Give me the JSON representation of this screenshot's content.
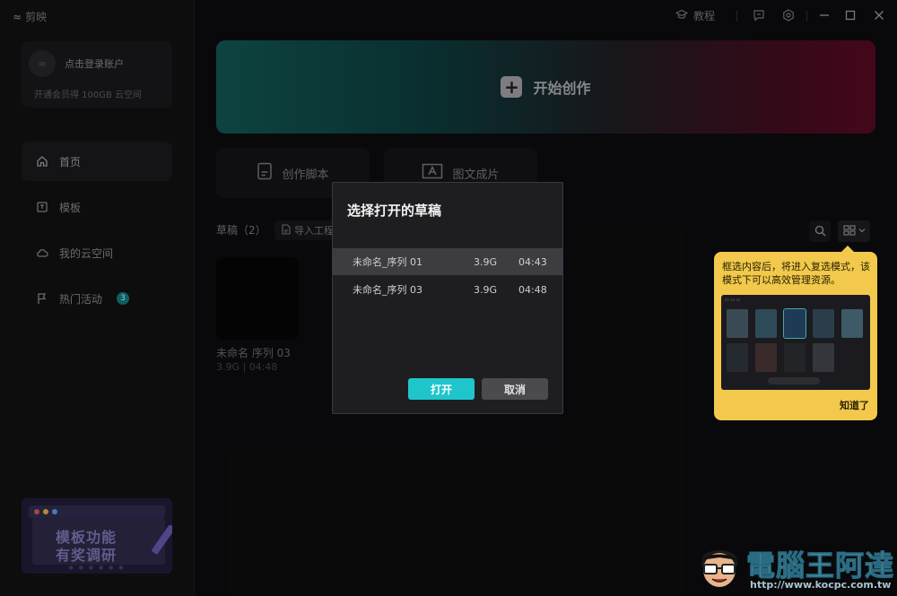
{
  "app": {
    "title": "剪映"
  },
  "account": {
    "login": "点击登录账户",
    "vip": "开通会员得 100GB 云空间"
  },
  "nav": [
    {
      "id": "home",
      "label": "首页",
      "icon": "home-icon"
    },
    {
      "id": "template",
      "label": "模板",
      "icon": "template-icon"
    },
    {
      "id": "cloud",
      "label": "我的云空间",
      "icon": "cloud-icon"
    },
    {
      "id": "events",
      "label": "热门活动",
      "icon": "flag-icon",
      "badge": "3"
    }
  ],
  "promo": {
    "line1": "模板功能",
    "line2": "有奖调研"
  },
  "topbar": {
    "tutorial": "教程"
  },
  "main": {
    "start_label": "开始创作",
    "script_label": "创作脚本",
    "image_text_label": "图文成片",
    "drafts_label": "草稿（2）",
    "import_label": "导入工程"
  },
  "draft": {
    "name": "未命名 序列 03",
    "meta": "3.9G | 04:48"
  },
  "modal": {
    "title": "选择打开的草稿",
    "rows": [
      {
        "name": "未命名_序列 01",
        "size": "3.9G",
        "time": "04:43"
      },
      {
        "name": "未命名_序列 03",
        "size": "3.9G",
        "time": "04:48"
      }
    ],
    "open_label": "打开",
    "cancel_label": "取消"
  },
  "tip": {
    "text": "框选内容后，将进入复选模式，该模式下可以高效管理资源。",
    "ok_label": "知道了"
  },
  "watermark": {
    "title": "電腦王阿達",
    "url": "http://www.kocpc.com.tw"
  },
  "colors": {
    "accent": "#1ec6cb",
    "tip_bg": "#f2c94c"
  }
}
